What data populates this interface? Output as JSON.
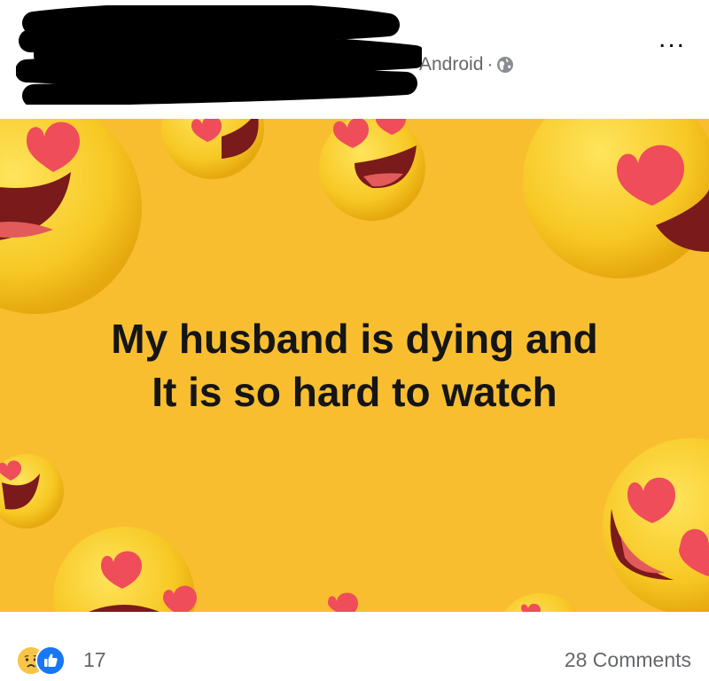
{
  "post": {
    "source": "Android",
    "separator": "·",
    "privacy_icon": "globe-icon",
    "more_icon": "more-options-icon",
    "more_label": "...",
    "text_line1": "My husband is dying and",
    "text_line2": "It is so hard to watch",
    "banner_color": "#f8be30",
    "decoration": "heart-eyes-emoji"
  },
  "footer": {
    "reaction_icons": [
      "sad-reaction-icon",
      "like-reaction-icon"
    ],
    "reaction_count": "17",
    "comments": "28 Comments"
  }
}
